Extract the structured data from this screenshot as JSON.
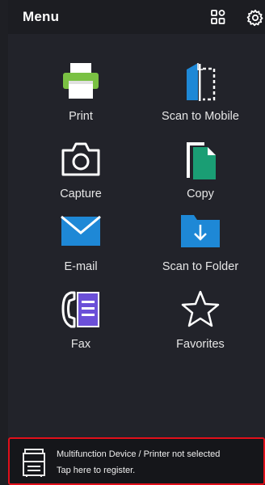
{
  "header": {
    "title": "Menu",
    "icons": [
      "grid-icon",
      "gear-icon"
    ]
  },
  "menu": {
    "items": [
      {
        "label": "Print",
        "icon": "printer-icon"
      },
      {
        "label": "Scan to Mobile",
        "icon": "scan-to-mobile-icon"
      },
      {
        "label": "Capture",
        "icon": "camera-icon"
      },
      {
        "label": "Copy",
        "icon": "copy-icon"
      },
      {
        "label": "E-mail",
        "icon": "envelope-icon"
      },
      {
        "label": "Scan to Folder",
        "icon": "folder-download-icon"
      },
      {
        "label": "Fax",
        "icon": "fax-icon"
      },
      {
        "label": "Favorites",
        "icon": "star-icon"
      }
    ]
  },
  "footer": {
    "line1": "Multifunction Device / Printer not selected",
    "line2": "Tap here to register.",
    "icon": "multifunction-device-icon"
  },
  "colors": {
    "background": "#22232a",
    "accent_blue": "#1e88d6",
    "accent_green": "#7ac143",
    "copy_green": "#1a9e74",
    "fax_purple": "#6b4fd8",
    "footer_border": "#e20f1a"
  }
}
